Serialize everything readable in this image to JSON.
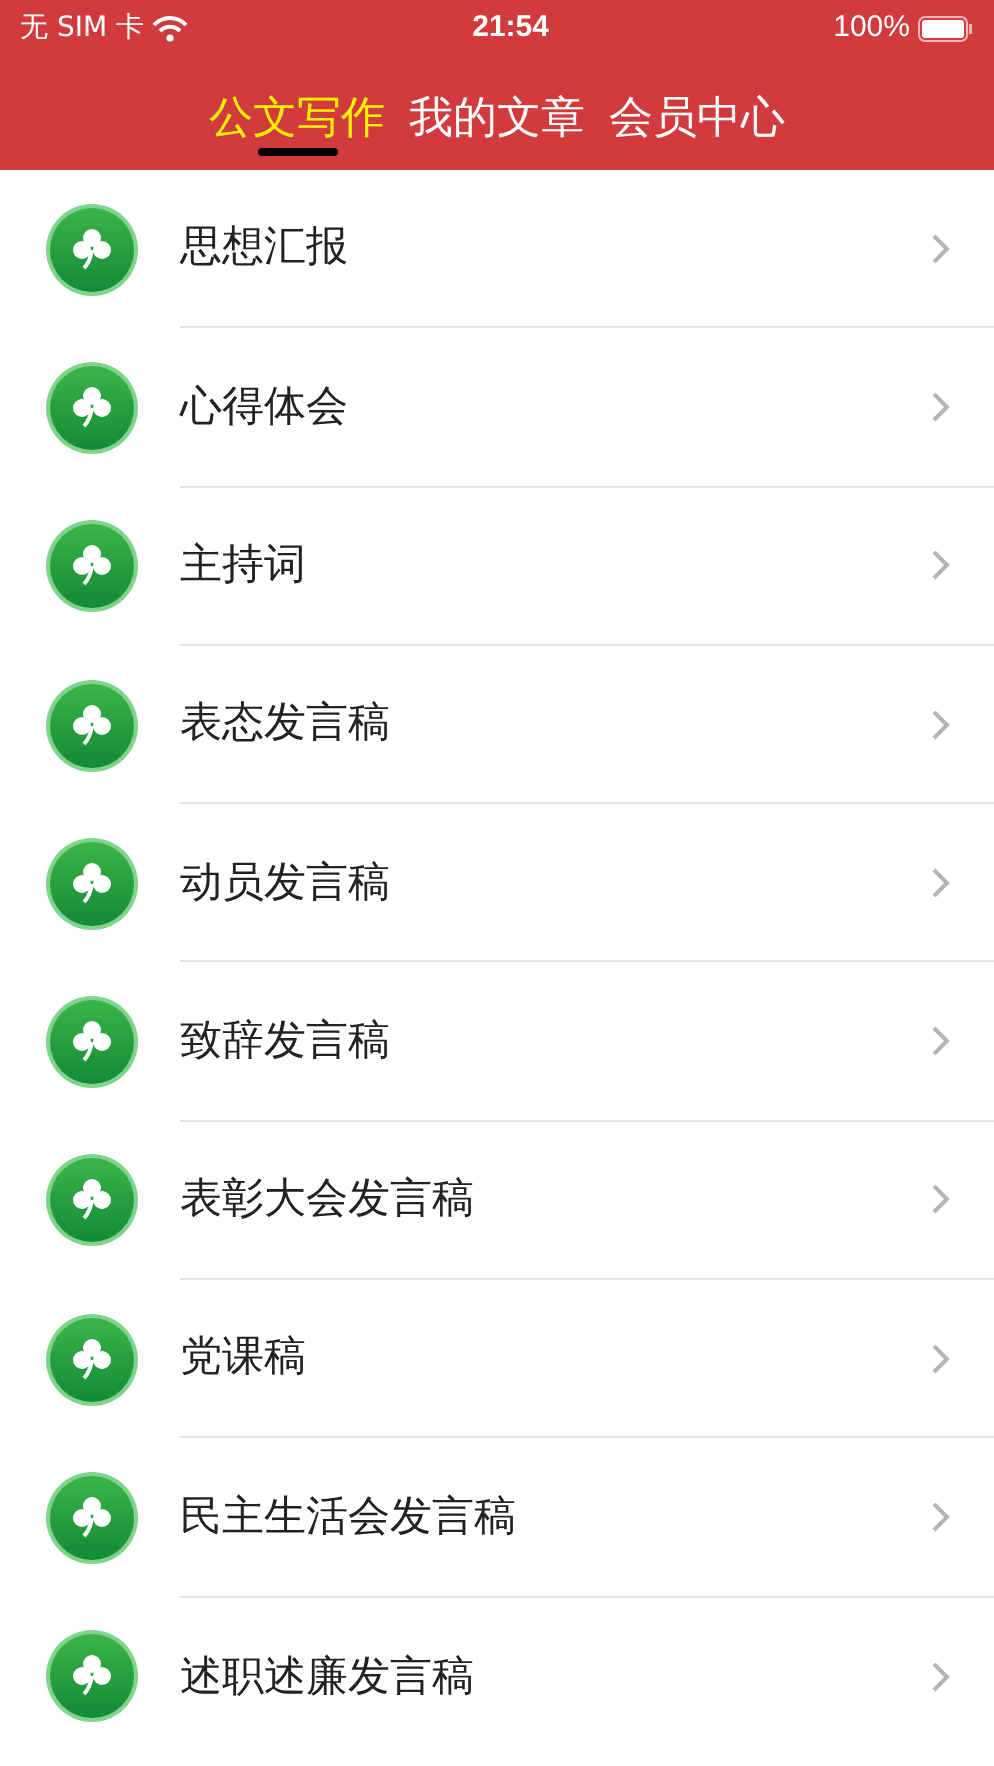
{
  "status_bar": {
    "carrier": "无 SIM 卡",
    "time": "21:54",
    "battery": "100%"
  },
  "tabs": [
    {
      "label": "公文写作",
      "selected": true
    },
    {
      "label": "我的文章",
      "selected": false
    },
    {
      "label": "会员中心",
      "selected": false
    }
  ],
  "items": [
    {
      "label": "思想汇报"
    },
    {
      "label": "心得体会"
    },
    {
      "label": "主持词"
    },
    {
      "label": "表态发言稿"
    },
    {
      "label": "动员发言稿"
    },
    {
      "label": "致辞发言稿"
    },
    {
      "label": "表彰大会发言稿"
    },
    {
      "label": "党课稿"
    },
    {
      "label": "民主生活会发言稿"
    },
    {
      "label": "述职述廉发言稿"
    }
  ]
}
